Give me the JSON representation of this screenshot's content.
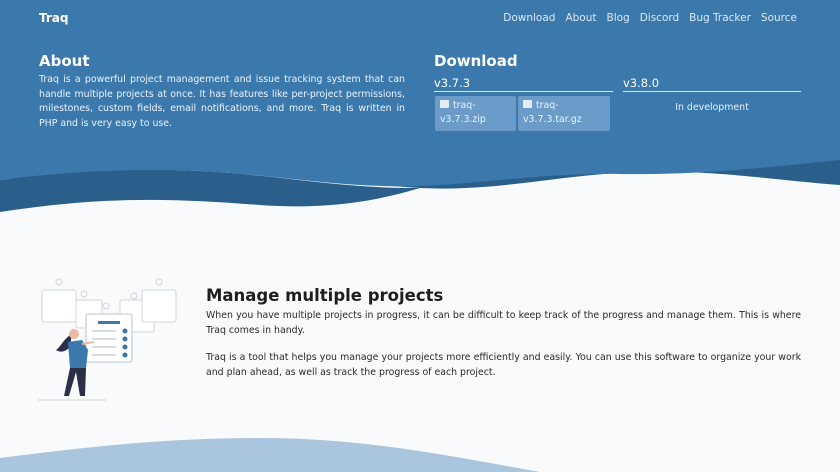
{
  "brand": "Traq",
  "nav": [
    "Download",
    "About",
    "Blog",
    "Discord",
    "Bug Tracker",
    "Source"
  ],
  "about": {
    "title": "About",
    "text": "Traq is a powerful project management and issue tracking system that can handle multiple projects at once. It has features like per-project permissions, milestones, custom fields, email notifications, and more. Traq is written in PHP and is very easy to use."
  },
  "download": {
    "title": "Download",
    "stable_version": "v3.7.3",
    "dev_version": "v3.8.0",
    "zip_label_1": "traq-",
    "zip_label_2": "v3.7.3.zip",
    "tar_label_1": "traq-",
    "tar_label_2": "v3.7.3.tar.gz",
    "dev_note": "In development",
    "icon": "archive-icon"
  },
  "feature": {
    "title": "Manage multiple projects",
    "p1": "When you have multiple projects in progress, it can be difficult to keep track of the progress and manage them. This is where Traq comes in handy.",
    "p2": "Traq is a tool that helps you manage your projects more efficiently and easily. You can use this software to organize your work and plan ahead, as well as track the progress of each project."
  },
  "colors": {
    "hero_blue": "#3b79ad",
    "wave_dark": "#2a5f8c",
    "button_bg": "#6b9cc9",
    "page_bg": "#f8fafc",
    "bottom_wave": "#a9c6de"
  }
}
